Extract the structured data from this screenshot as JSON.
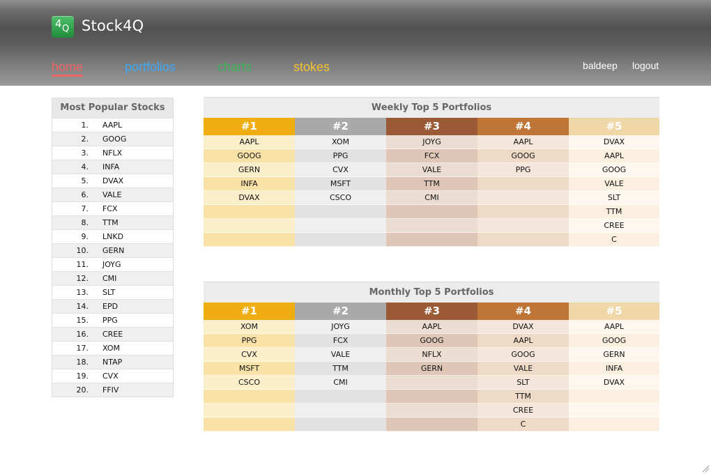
{
  "app": {
    "title": "Stock4Q",
    "logo_mark_4": "4",
    "logo_mark_q": "Q"
  },
  "nav": {
    "home": {
      "label": "home",
      "color": "#ef6464"
    },
    "portfolios": {
      "label": "portfolios",
      "color": "#3fa9f5"
    },
    "charts": {
      "label": "charts",
      "color": "#3cb55a"
    },
    "stokes": {
      "label": "stokes",
      "color": "#f4c430"
    }
  },
  "user": {
    "name": "baldeep",
    "logout_label": "logout"
  },
  "popular": {
    "title": "Most Popular Stocks",
    "items": [
      {
        "rank": "1.",
        "symbol": "AAPL"
      },
      {
        "rank": "2.",
        "symbol": "GOOG"
      },
      {
        "rank": "3.",
        "symbol": "NFLX"
      },
      {
        "rank": "4.",
        "symbol": "INFA"
      },
      {
        "rank": "5.",
        "symbol": "DVAX"
      },
      {
        "rank": "6.",
        "symbol": "VALE"
      },
      {
        "rank": "7.",
        "symbol": "FCX"
      },
      {
        "rank": "8.",
        "symbol": "TTM"
      },
      {
        "rank": "9.",
        "symbol": "LNKD"
      },
      {
        "rank": "10.",
        "symbol": "GERN"
      },
      {
        "rank": "11.",
        "symbol": "JOYG"
      },
      {
        "rank": "12.",
        "symbol": "CMI"
      },
      {
        "rank": "13.",
        "symbol": "SLT"
      },
      {
        "rank": "14.",
        "symbol": "EPD"
      },
      {
        "rank": "15.",
        "symbol": "PPG"
      },
      {
        "rank": "16.",
        "symbol": "CREE"
      },
      {
        "rank": "17.",
        "symbol": "XOM"
      },
      {
        "rank": "18.",
        "symbol": "NTAP"
      },
      {
        "rank": "19.",
        "symbol": "CVX"
      },
      {
        "rank": "20.",
        "symbol": "FFIV"
      }
    ]
  },
  "columns": [
    {
      "label": "#1",
      "head": "#f0ad12",
      "a": "#f8e2a8",
      "b": "#fbeecb"
    },
    {
      "label": "#2",
      "head": "#a9a9a9",
      "a": "#e2e2e2",
      "b": "#efefef"
    },
    {
      "label": "#3",
      "head": "#9b5a36",
      "a": "#dfc6b6",
      "b": "#ecddd2"
    },
    {
      "label": "#4",
      "head": "#bf7535",
      "a": "#eedac7",
      "b": "#f4e6da"
    },
    {
      "label": "#5",
      "head": "#f0d7a8",
      "a": "#fbf0e0",
      "b": "#fdf7ef"
    }
  ],
  "weekly": {
    "title": "Weekly Top 5 Portfolios",
    "rows": 8,
    "portfolios": [
      [
        "AAPL",
        "GOOG",
        "GERN",
        "INFA",
        "DVAX"
      ],
      [
        "XOM",
        "PPG",
        "CVX",
        "MSFT",
        "CSCO"
      ],
      [
        "JOYG",
        "FCX",
        "VALE",
        "TTM",
        "CMI"
      ],
      [
        "AAPL",
        "GOOG",
        "PPG"
      ],
      [
        "DVAX",
        "AAPL",
        "GOOG",
        "VALE",
        "SLT",
        "TTM",
        "CREE",
        "C"
      ]
    ]
  },
  "monthly": {
    "title": "Monthly Top 5 Portfolios",
    "rows": 8,
    "portfolios": [
      [
        "XOM",
        "PPG",
        "CVX",
        "MSFT",
        "CSCO"
      ],
      [
        "JOYG",
        "FCX",
        "VALE",
        "TTM",
        "CMI"
      ],
      [
        "AAPL",
        "GOOG",
        "NFLX",
        "GERN"
      ],
      [
        "DVAX",
        "AAPL",
        "GOOG",
        "VALE",
        "SLT",
        "TTM",
        "CREE",
        "C"
      ],
      [
        "AAPL",
        "GOOG",
        "GERN",
        "INFA",
        "DVAX"
      ]
    ]
  }
}
